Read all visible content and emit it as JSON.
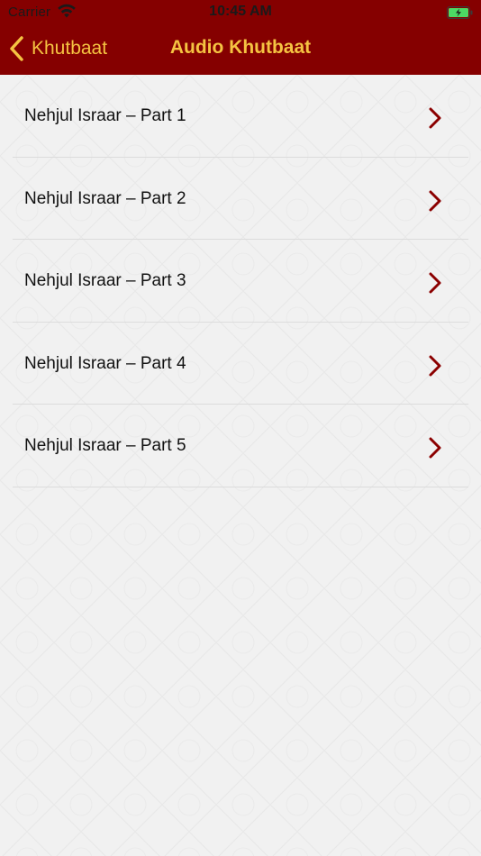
{
  "status_bar": {
    "carrier": "Carrier",
    "time": "10:45 AM",
    "wifi_icon": "wifi-icon",
    "battery_icon": "battery-charging-icon",
    "battery_color": "#4cd964"
  },
  "nav": {
    "back_label": "Khutbaat",
    "title": "Audio Khutbaat",
    "back_icon": "chevron-left-icon",
    "bar_color": "#850000",
    "accent_color": "#f5c342"
  },
  "list": {
    "chevron_icon": "chevron-right-icon",
    "chevron_color": "#8b0000",
    "items": [
      {
        "label": "Nehjul Israar – Part 1"
      },
      {
        "label": "Nehjul Israar – Part 2"
      },
      {
        "label": "Nehjul Israar – Part 3"
      },
      {
        "label": "Nehjul Israar – Part 4"
      },
      {
        "label": "Nehjul Israar – Part 5"
      }
    ]
  }
}
